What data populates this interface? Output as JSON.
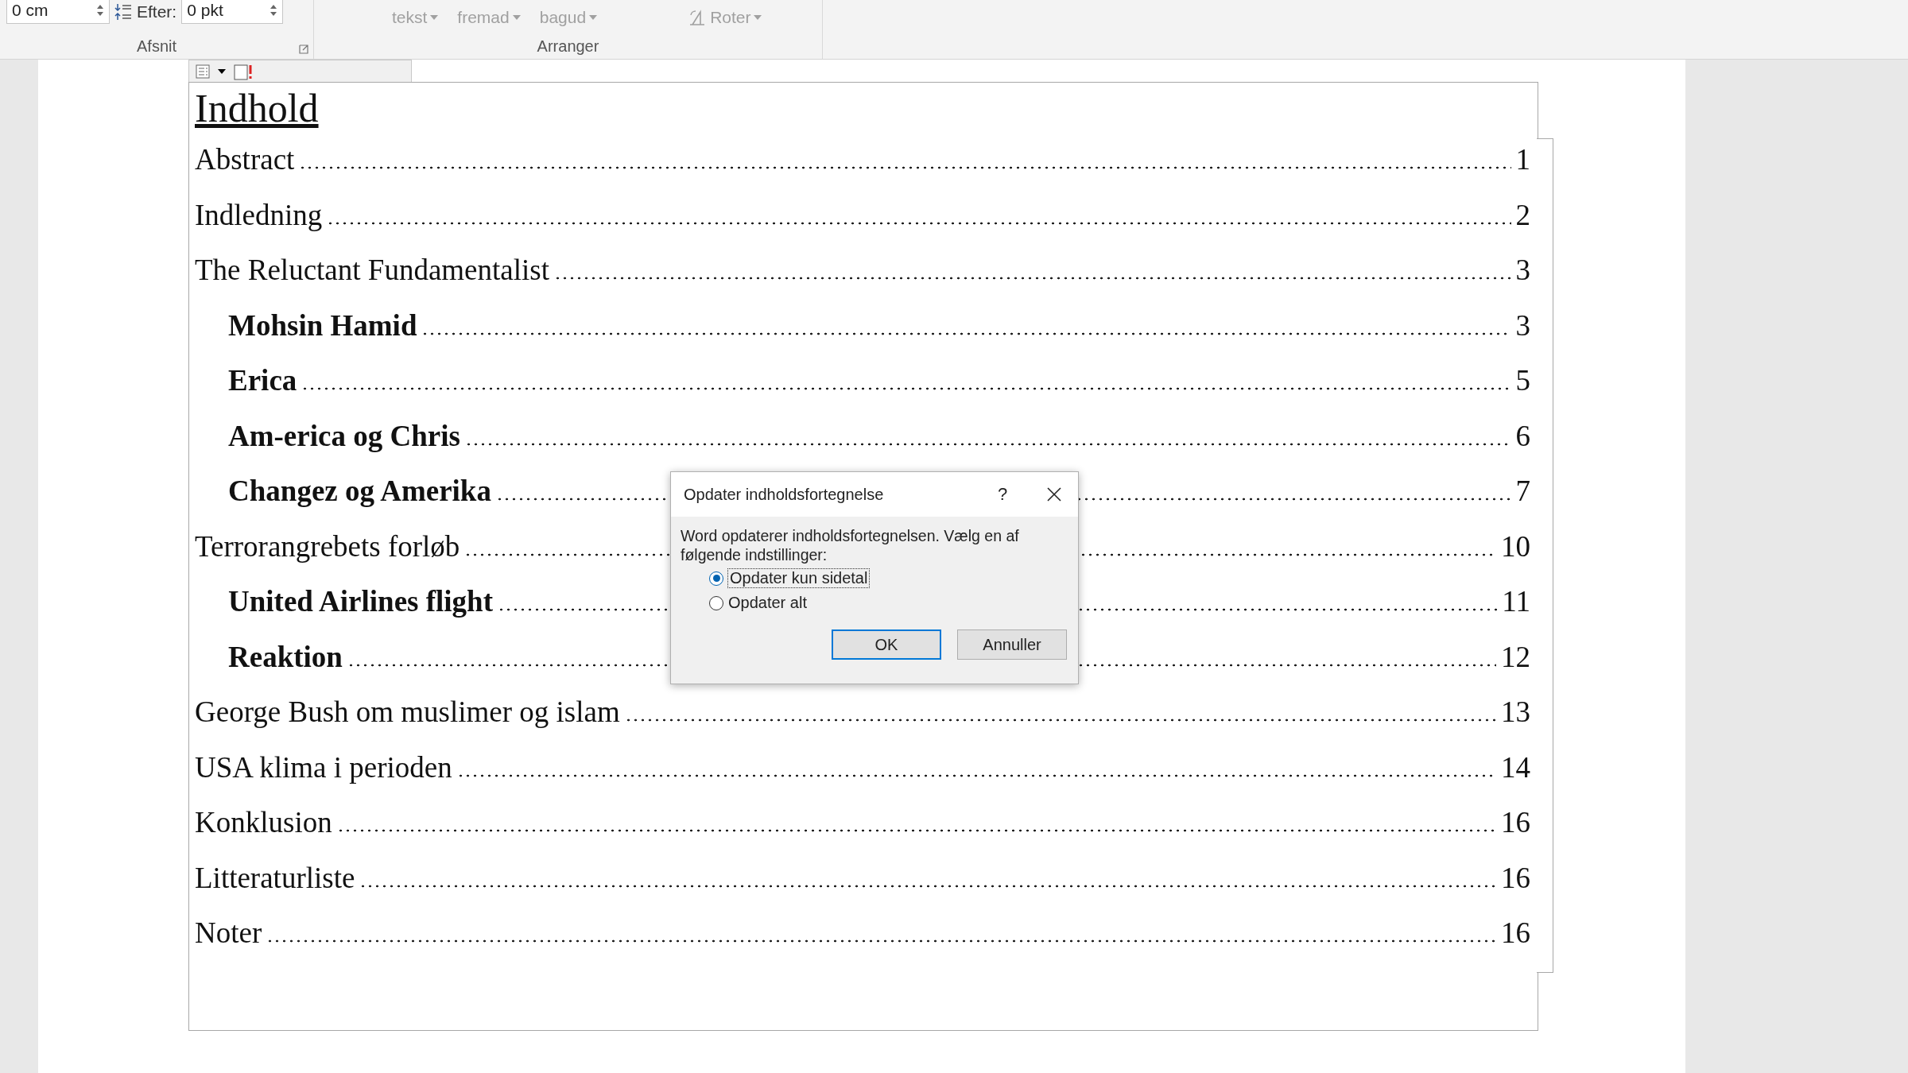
{
  "ribbon": {
    "paragraph_group": {
      "indent_value": "0 cm",
      "after_label": "Efter:",
      "after_value": "0 pkt",
      "label": "Afsnit"
    },
    "arrange_group": {
      "buttons": [
        {
          "label": "tekst",
          "kind": "dropdown",
          "disabled": true
        },
        {
          "label": "fremad",
          "kind": "dropdown",
          "disabled": true
        },
        {
          "label": "bagud",
          "kind": "dropdown",
          "disabled": true
        },
        {
          "label": "Roter",
          "kind": "rotate",
          "disabled": true
        }
      ],
      "label": "Arranger"
    }
  },
  "document": {
    "toc": {
      "title": "Indhold",
      "entries": [
        {
          "text": "Abstract",
          "page": "1"
        },
        {
          "text": "Indledning",
          "page": "2"
        },
        {
          "text": "The Reluctant Fundamentalist",
          "page": "3",
          "children": [
            {
              "text": "Mohsin Hamid",
              "page": "3"
            },
            {
              "text": "Erica",
              "page": "5"
            },
            {
              "text": "Am-erica og Chris",
              "page": "6"
            },
            {
              "text": "Changez og Amerika",
              "page": "7"
            }
          ]
        },
        {
          "text": "Terrorangrebets forløb",
          "page": "10",
          "children": [
            {
              "text": "United Airlines flight",
              "page": "11"
            },
            {
              "text": "Reaktion",
              "page": "12"
            }
          ]
        },
        {
          "text": "George Bush om muslimer og islam",
          "page": "13"
        },
        {
          "text": "USA klima i perioden",
          "page": "14"
        },
        {
          "text": "Konklusion",
          "page": "16"
        },
        {
          "text": "Litteraturliste",
          "page": "16"
        },
        {
          "text": "Noter",
          "page": "16"
        }
      ]
    }
  },
  "dialog": {
    "title": "Opdater indholdsfortegnelse",
    "help": "?",
    "message": "Word opdaterer indholdsfortegnelsen. Vælg en af følgende indstillinger:",
    "options": [
      {
        "label": "Opdater kun sidetal",
        "selected": true
      },
      {
        "label": "Opdater alt",
        "selected": false
      }
    ],
    "buttons": [
      {
        "label": "OK",
        "default": true
      },
      {
        "label": "Annuller",
        "default": false
      }
    ]
  }
}
